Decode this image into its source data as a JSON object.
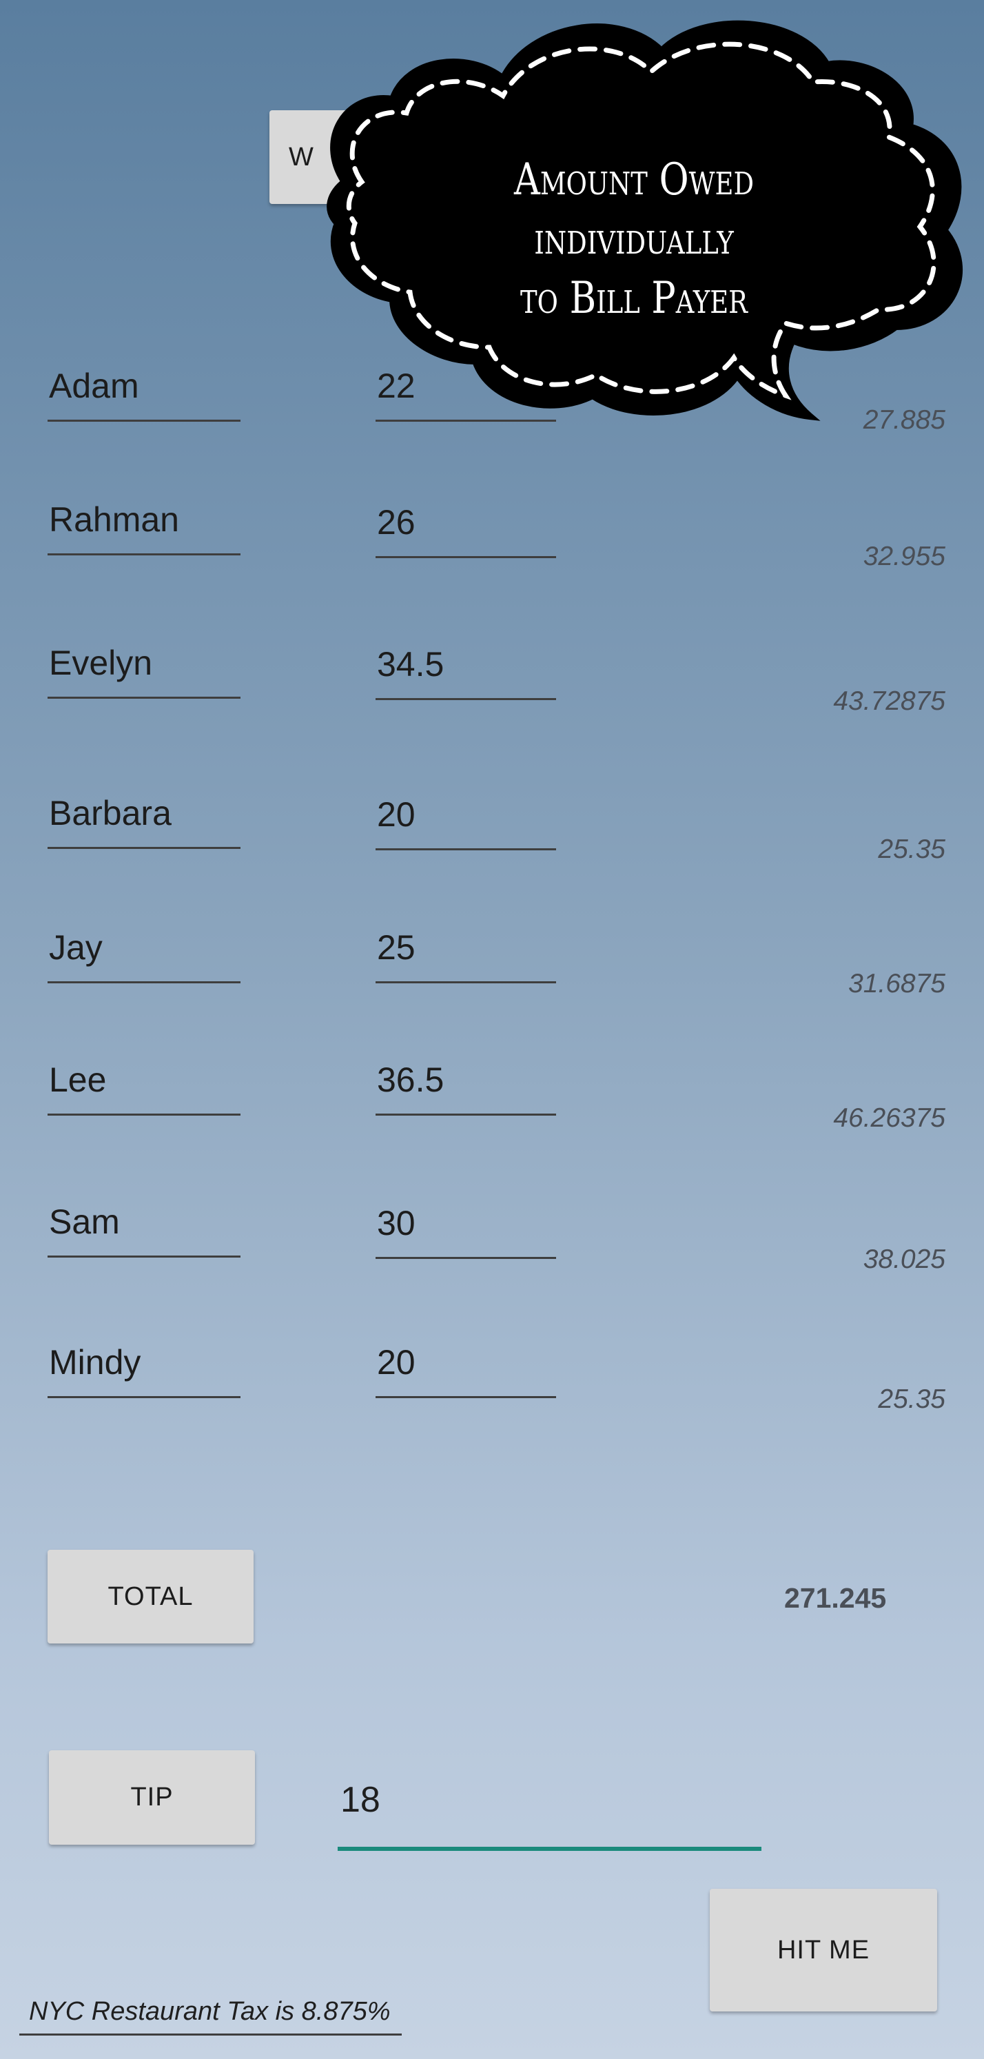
{
  "header": {
    "button_label": "W"
  },
  "callout": {
    "line1": "Amount Owed individually",
    "line2": "to Bill Payer"
  },
  "people": [
    {
      "name": "Adam",
      "amount": "22",
      "owed": "27.885"
    },
    {
      "name": "Rahman",
      "amount": "26",
      "owed": "32.955"
    },
    {
      "name": "Evelyn",
      "amount": "34.5",
      "owed": "43.72875"
    },
    {
      "name": "Barbara",
      "amount": "20",
      "owed": "25.35"
    },
    {
      "name": "Jay",
      "amount": "25",
      "owed": "31.6875"
    },
    {
      "name": "Lee",
      "amount": "36.5",
      "owed": "46.26375"
    },
    {
      "name": "Sam",
      "amount": "30",
      "owed": "38.025"
    },
    {
      "name": "Mindy",
      "amount": "20",
      "owed": "25.35"
    }
  ],
  "total": {
    "button_label": "TOTAL",
    "value": "271.245"
  },
  "tip": {
    "button_label": "TIP",
    "value": "18"
  },
  "hit_me_label": "HIT ME",
  "tax_note": "NYC Restaurant Tax is 8.875%",
  "colors": {
    "accent_underline": "#1a8a7c",
    "cloud": "#000000"
  }
}
